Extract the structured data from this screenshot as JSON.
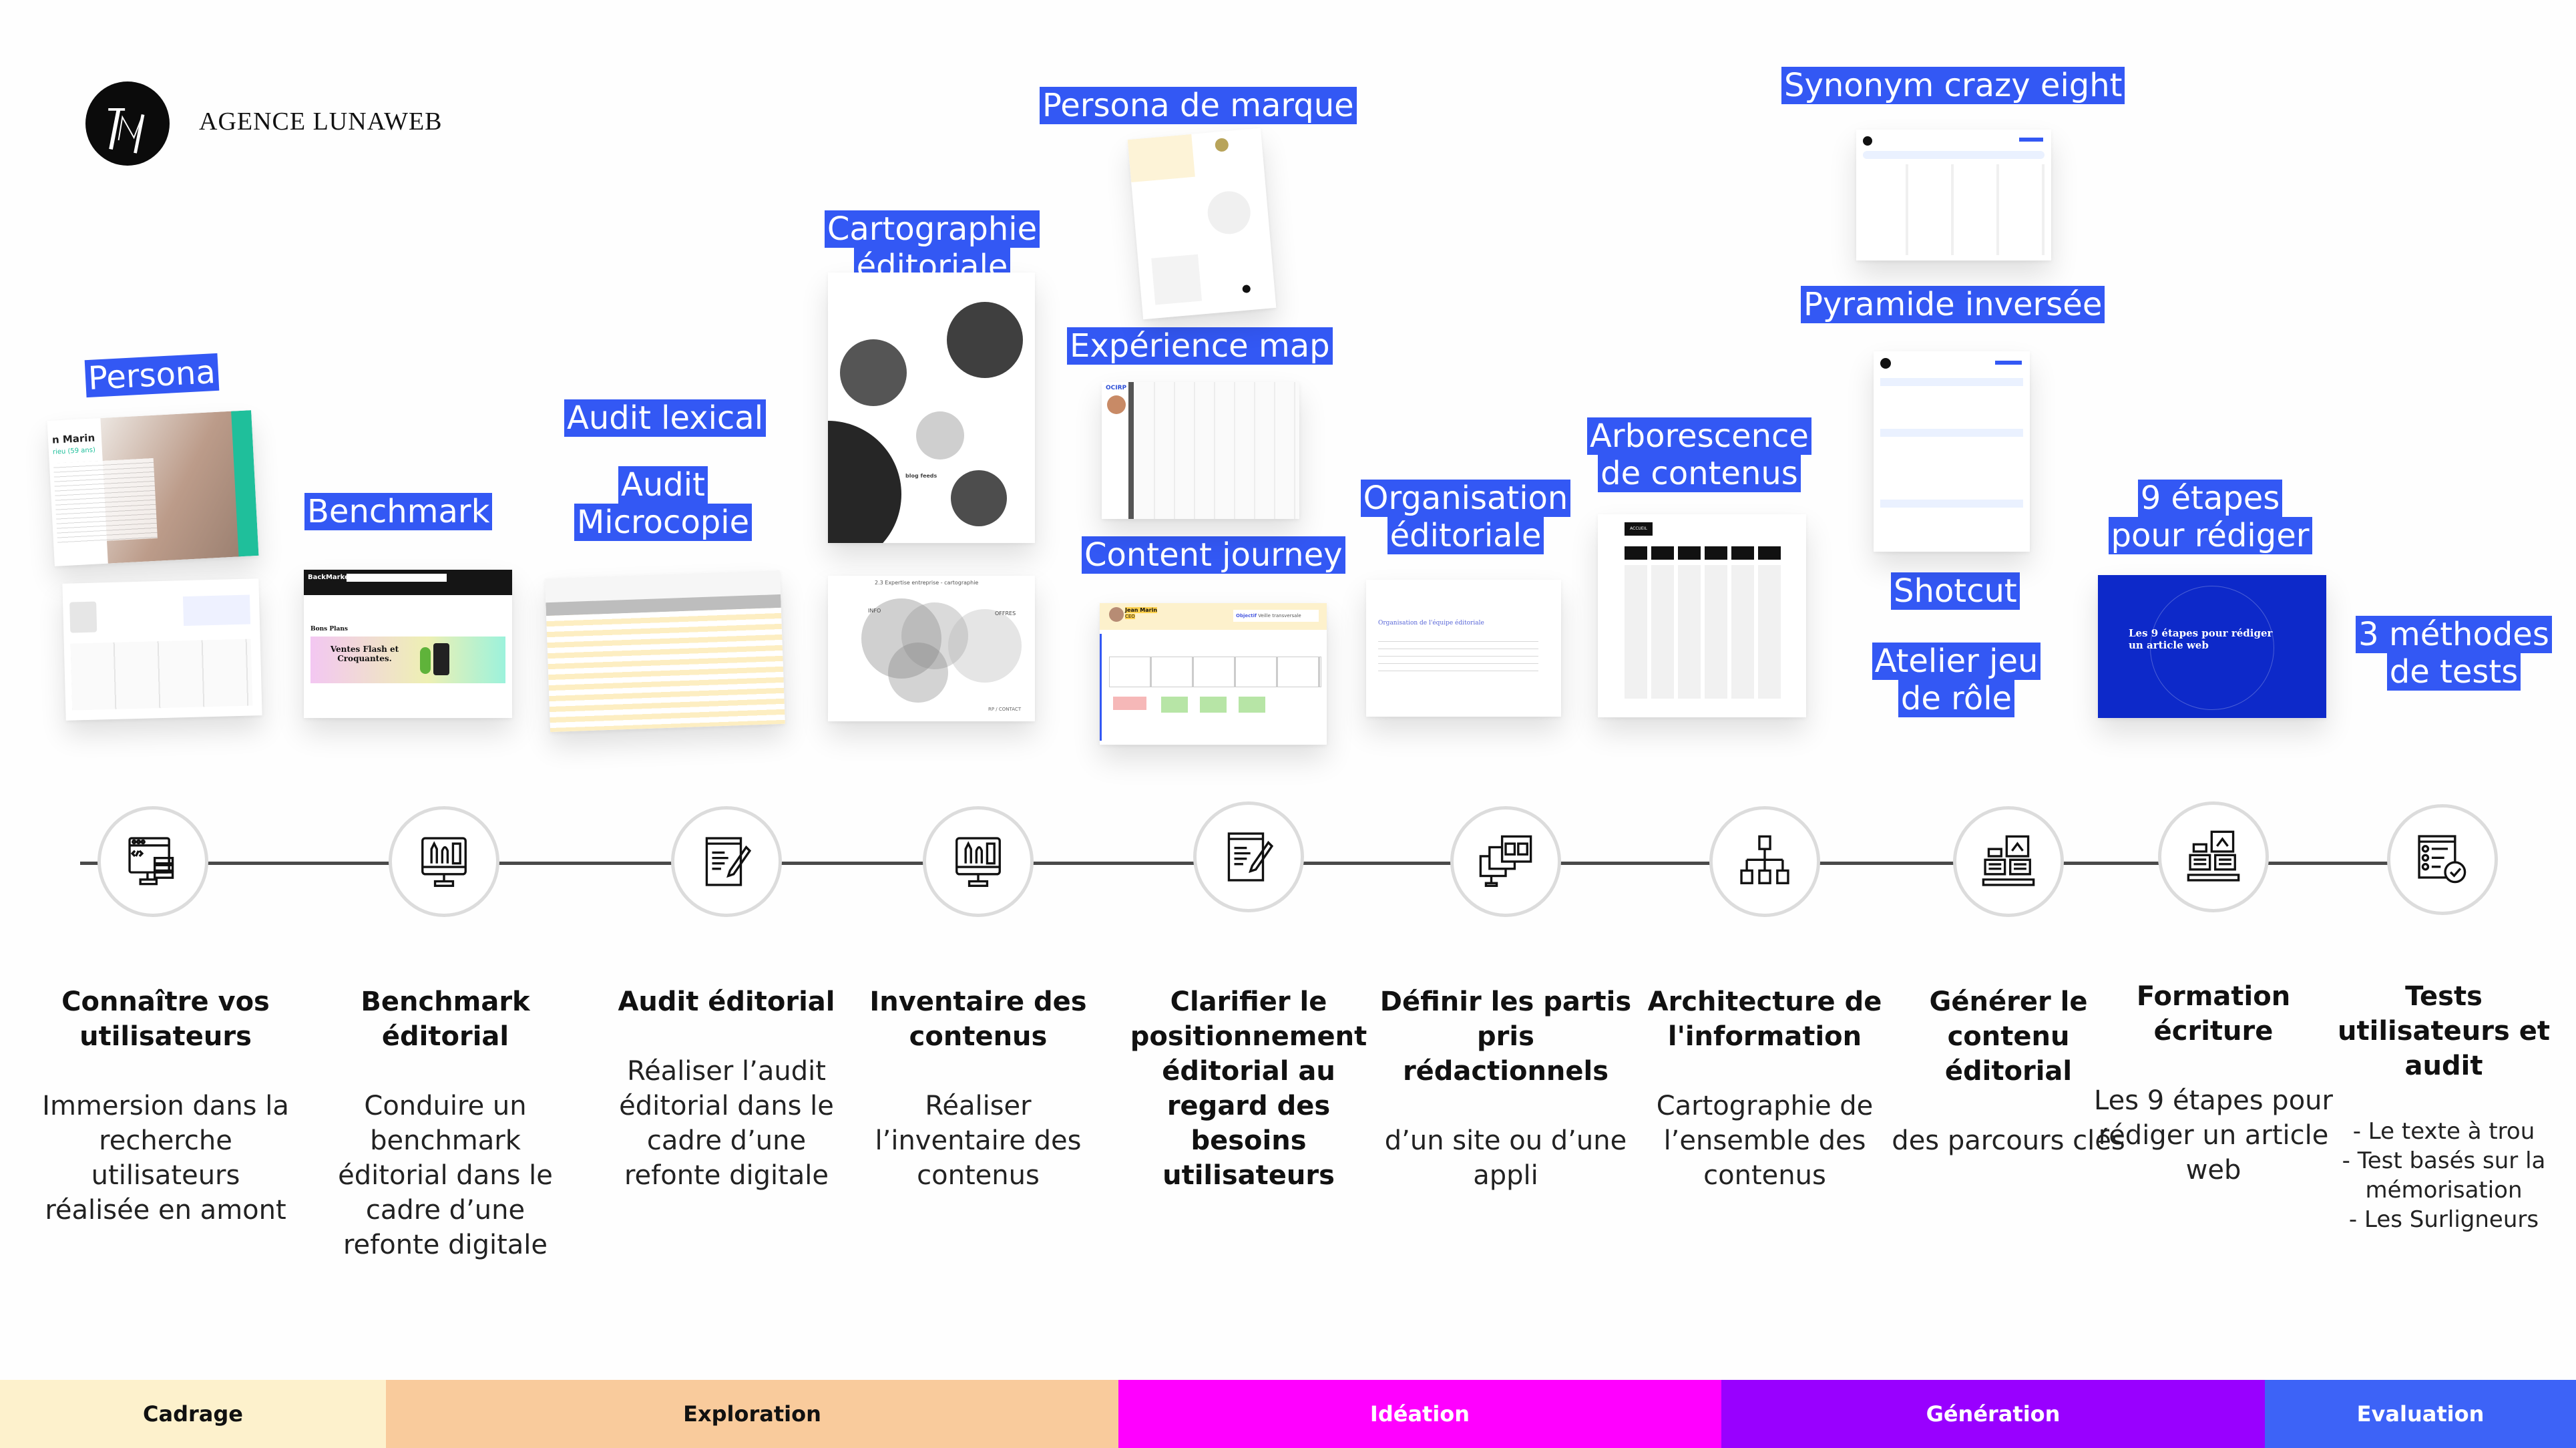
{
  "brand": {
    "name": "AGENCE LUNAWEB",
    "logo_icon": "lw-monogram-icon"
  },
  "tools": [
    {
      "id": "persona",
      "label": "Persona"
    },
    {
      "id": "benchmark",
      "label": "Benchmark"
    },
    {
      "id": "audit-lexical",
      "label": "Audit lexical"
    },
    {
      "id": "audit-microcopie",
      "label": "Audit Microcopie"
    },
    {
      "id": "cartographie",
      "label": "Cartographie éditoriale"
    },
    {
      "id": "persona-marque",
      "label": "Persona de marque"
    },
    {
      "id": "experience-map",
      "label": "Expérience map"
    },
    {
      "id": "content-journey",
      "label": "Content journey"
    },
    {
      "id": "organisation",
      "label": "Organisation éditoriale"
    },
    {
      "id": "arborescence",
      "label": "Arborescence de contenus"
    },
    {
      "id": "synonym",
      "label": "Synonym crazy eight"
    },
    {
      "id": "pyramide",
      "label": "Pyramide inversée"
    },
    {
      "id": "shotcut",
      "label": "Shotcut"
    },
    {
      "id": "atelier",
      "label": "Atelier jeu de rôle"
    },
    {
      "id": "neuf-etapes",
      "label": "9 étapes pour rédiger"
    },
    {
      "id": "trois-methodes",
      "label": "3 méthodes de tests"
    }
  ],
  "thumbnails": {
    "persona": {
      "name": "n Marin",
      "subtitle": "rieu (59 ans)"
    },
    "benchmark": {
      "brand": "BackMarket",
      "heading": "Bons Plans",
      "banner_title": "Ventes Flash et Croquantes."
    },
    "cartographie_top": {
      "caption": "blog feeds"
    },
    "cartographie_bottom": {
      "title": "2.3 Expertise entreprise - cartographie",
      "labels": [
        "INFO",
        "OFFRES",
        "RP / CONTACT"
      ]
    },
    "experience_map": {
      "brand": "OCIRP"
    },
    "content_journey": {
      "persona": "Jean Marin",
      "role": "CEO",
      "objective_label": "Objectif",
      "objective": "Veille transversale"
    },
    "organisation": {
      "title": "Organisation de l'équipe éditoriale"
    },
    "arborescence": {
      "root": "ACCUEIL"
    },
    "neuf_etapes": {
      "title": "Les 9 étapes pour rédiger un article web"
    }
  },
  "steps": [
    {
      "title": "Connaître vos utilisateurs",
      "desc": "Immersion dans la recherche utilisateurs réalisée en amont",
      "icon": "code-monitor-icon"
    },
    {
      "title": "Benchmark éditorial",
      "desc": "Conduire un benchmark éditorial dans le cadre d’une refonte digitale",
      "icon": "design-tools-monitor-icon"
    },
    {
      "title": "Audit éditorial",
      "desc": "Réaliser l’audit éditorial dans le cadre d’une refonte digitale",
      "icon": "document-edit-icon"
    },
    {
      "title": "Inventaire des contenus",
      "desc": "Réaliser l’inventaire des contenus",
      "icon": "design-tools-monitor-icon"
    },
    {
      "title": "Clarifier le positionnement éditorial au regard des besoins utilisateurs",
      "desc": "",
      "icon": "document-edit-icon"
    },
    {
      "title": "Définir les partis pris rédactionnels",
      "desc": "d’un site ou d’une appli",
      "icon": "multi-screen-icon"
    },
    {
      "title": "Architecture de l'information",
      "desc": "Cartographie de l’ensemble des contenus",
      "icon": "sitemap-icon"
    },
    {
      "title": "Générer le contenu éditorial",
      "desc": "des parcours clés",
      "icon": "content-generation-icon"
    },
    {
      "title": "Formation écriture",
      "desc": "Les 9 étapes pour rédiger un article web",
      "icon": "content-generation-icon"
    },
    {
      "title": "Tests utilisateurs et audit",
      "desc_lines": [
        "- Le texte à trou",
        "- Test basés sur la mémorisation",
        "- Les Surligneurs"
      ],
      "icon": "checklist-icon"
    }
  ],
  "phases": [
    {
      "label": "Cadrage",
      "color": "#fdf1cc",
      "text_color": "#111111"
    },
    {
      "label": "Exploration",
      "color": "#f9cb9c",
      "text_color": "#111111"
    },
    {
      "label": "Idéation",
      "color": "#ff00ff",
      "text_color": "#ffffff"
    },
    {
      "label": "Génération",
      "color": "#9900ff",
      "text_color": "#ffffff"
    },
    {
      "label": "Evaluation",
      "color": "#3d63f7",
      "text_color": "#ffffff"
    }
  ],
  "accent_color": "#3358f4"
}
